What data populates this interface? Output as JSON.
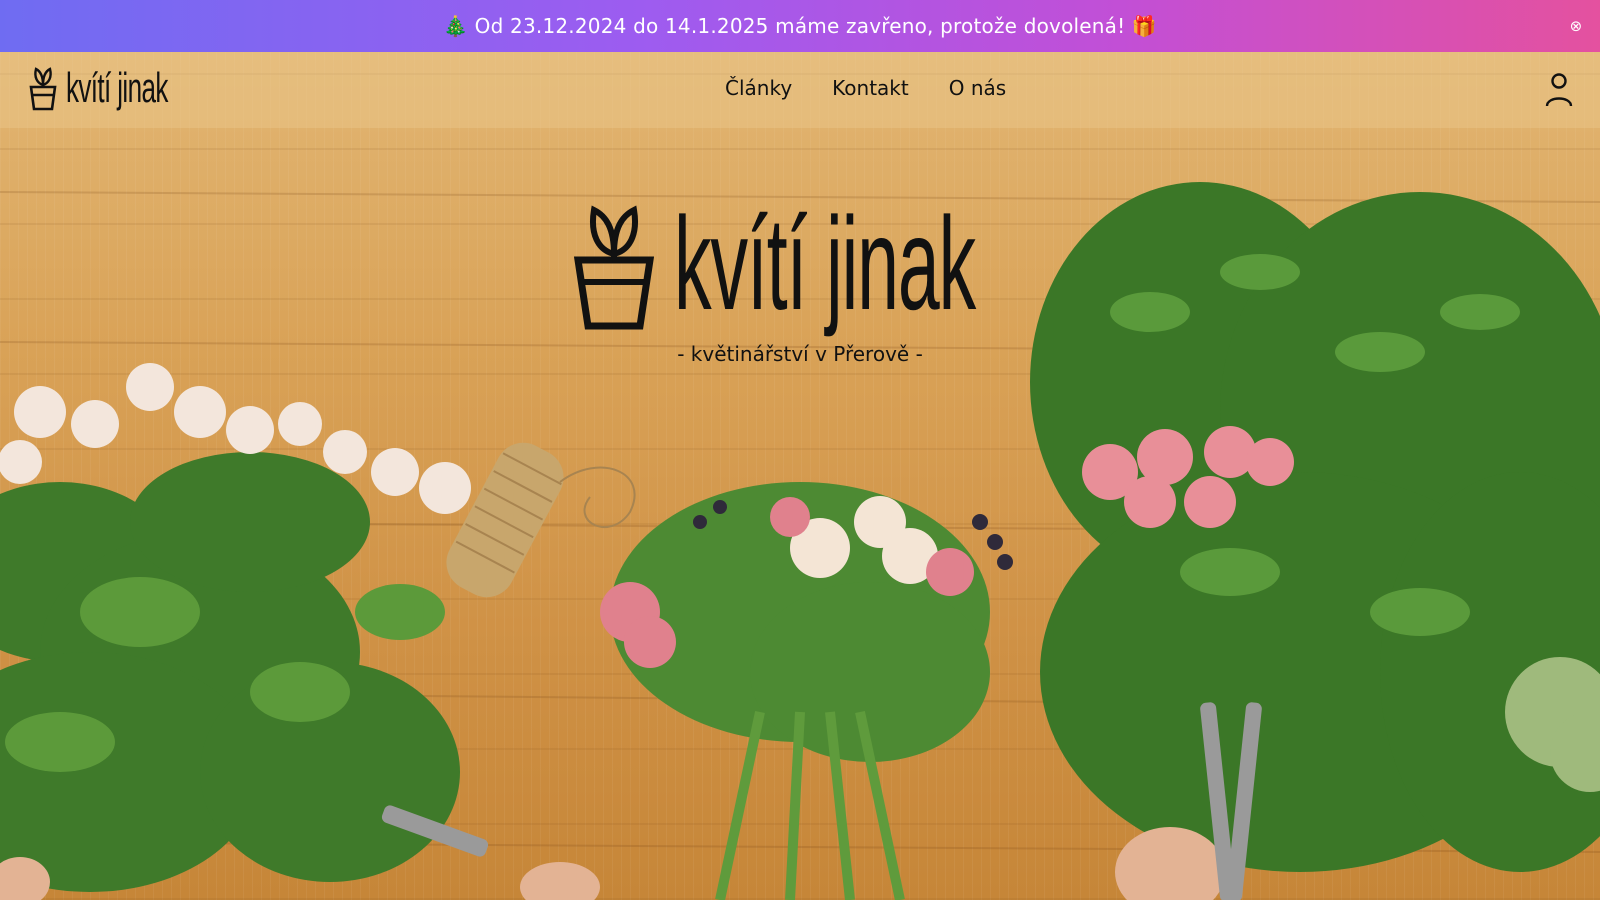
{
  "announcement": {
    "text": "🎄 Od 23.12.2024 do 14.1.2025 máme zavřeno, protože dovolená! 🎁",
    "close_icon": "⊗"
  },
  "header": {
    "logo_text": "kvítí jinak",
    "nav": [
      "Články",
      "Kontakt",
      "O nás"
    ]
  },
  "hero": {
    "logo_text": "kvítí jinak",
    "tagline": "- květinářství v Přerově -"
  },
  "colors": {
    "banner_start": "#6f6cf2",
    "banner_end": "#e4519f",
    "text": "#111111"
  },
  "icons": {
    "logo": "flower-pot-icon",
    "account": "user-icon",
    "close": "close-icon"
  }
}
